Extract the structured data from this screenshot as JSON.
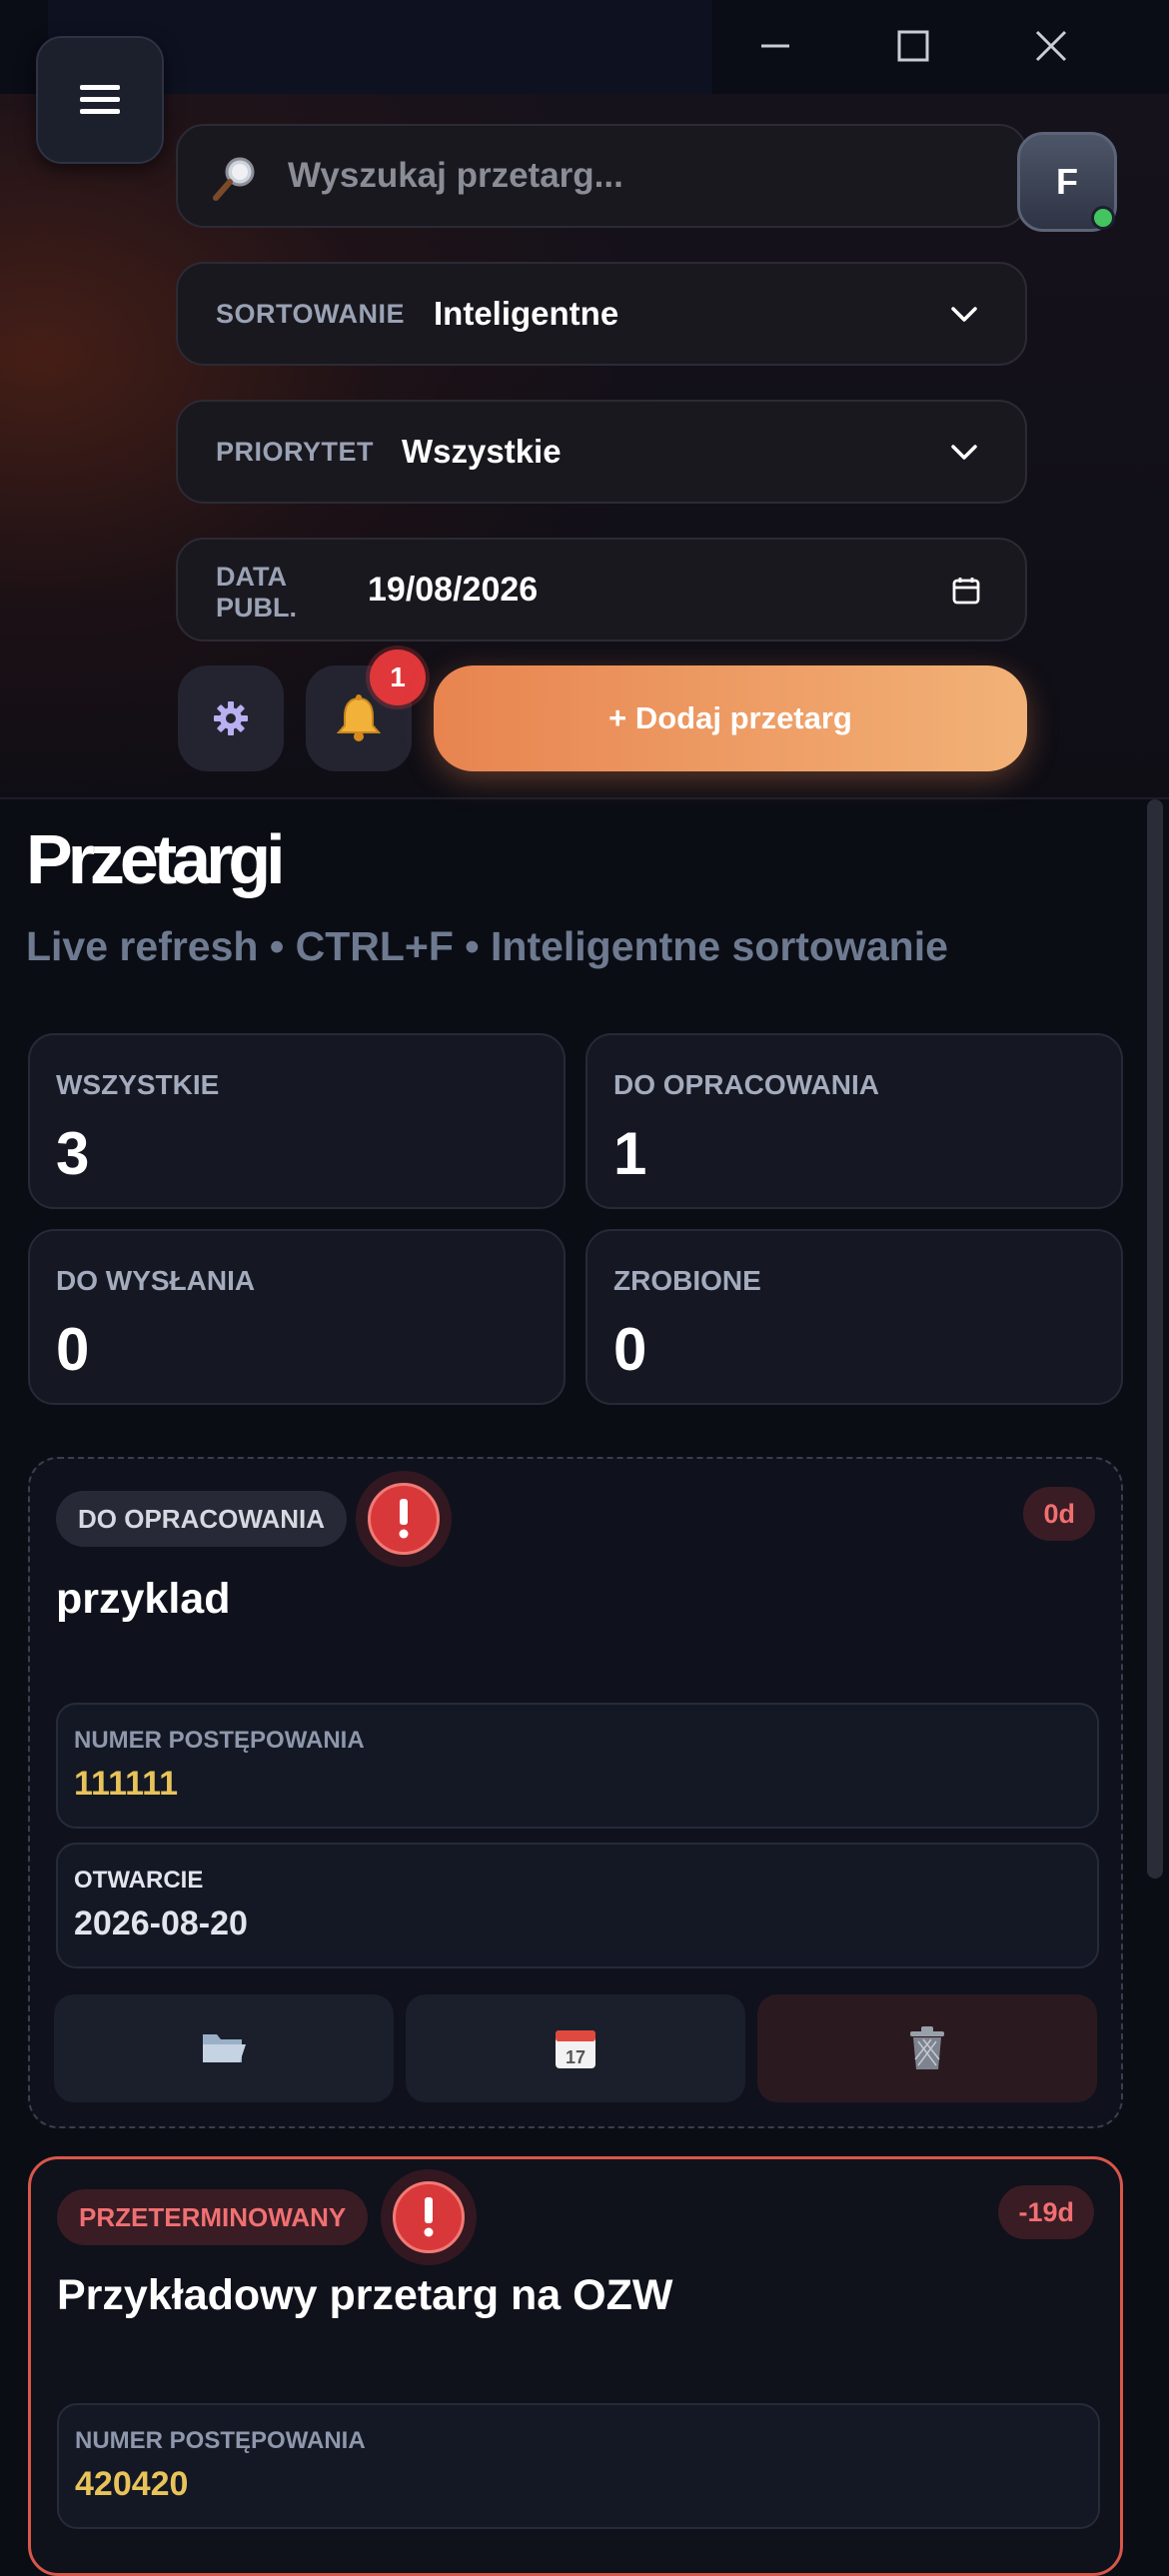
{
  "window": {
    "minimize": "minimize",
    "maximize": "maximize",
    "close": "close"
  },
  "header": {
    "search_placeholder": "Wyszukaj przetarg...",
    "avatar_initial": "F",
    "sort": {
      "label": "SORTOWANIE",
      "value": "Inteligentne"
    },
    "priority": {
      "label": "PRIORYTET",
      "value": "Wszystkie"
    },
    "date": {
      "label_line1": "DATA",
      "label_line2": "PUBL.",
      "value": "19/08/2026"
    },
    "notifications_count": "1",
    "add_button": "+ Dodaj przetarg"
  },
  "page": {
    "title": "Przetargi",
    "subtitle": "Live refresh • CTRL+F • Inteligentne sortowanie"
  },
  "stats": [
    {
      "label": "WSZYSTKIE",
      "value": "3"
    },
    {
      "label": "DO OPRACOWANIA",
      "value": "1"
    },
    {
      "label": "DO WYSŁANIA",
      "value": "0"
    },
    {
      "label": "ZROBIONE",
      "value": "0"
    }
  ],
  "cards": [
    {
      "status": "DO OPRACOWANIA",
      "days": "0d",
      "title": "przyklad",
      "number_label": "NUMER POSTĘPOWANIA",
      "number": "111111",
      "open_label": "OTWARCIE",
      "open_date": "2026-08-20"
    },
    {
      "status": "PRZETERMINOWANY",
      "days": "-19d",
      "title": "Przykładowy przetarg na OZW",
      "number_label": "NUMER POSTĘPOWANIA",
      "number": "420420"
    }
  ],
  "colors": {
    "accent": "#e88450",
    "danger": "#d9383b",
    "number": "#e8c35a",
    "muted": "#6e7a90"
  }
}
